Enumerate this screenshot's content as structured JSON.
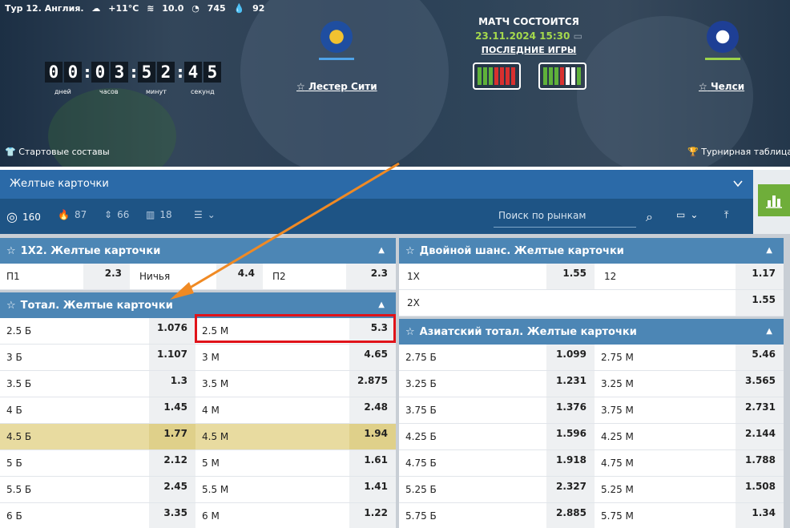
{
  "header": {
    "tour": "Тур 12. Англия.",
    "weather_temp": "+11°C",
    "wind": "10.0",
    "pressure": "745",
    "humidity": "92"
  },
  "countdown": {
    "digits": [
      "0",
      "0",
      "0",
      "3",
      "5",
      "2",
      "4",
      "5"
    ],
    "labels": [
      "дней",
      "часов",
      "минут",
      "секунд"
    ]
  },
  "match": {
    "status": "МАТЧ СОСТОИТСЯ",
    "datetime": "23.11.2024 15:30",
    "last_games": "ПОСЛЕДНИЕ ИГРЫ",
    "home": "Лестер Сити",
    "away": "Челси"
  },
  "links": {
    "lineups": "Стартовые составы",
    "table": "Турнирная таблица"
  },
  "market_select": "Желтые карточки",
  "toolbar": {
    "all": "160",
    "hot": "87",
    "updown": "66",
    "stats": "18",
    "search_placeholder": "Поиск по рынкам"
  },
  "panels": {
    "x12": {
      "title": "1X2. Желтые карточки",
      "cells": [
        {
          "label": "П1",
          "odd": "2.3"
        },
        {
          "label": "Ничья",
          "odd": "4.4"
        },
        {
          "label": "П2",
          "odd": "2.3"
        }
      ]
    },
    "total": {
      "title": "Тотал. Желтые карточки",
      "rows": [
        {
          "over": "2.5 Б",
          "over_odd": "1.076",
          "under": "2.5 М",
          "under_odd": "5.3"
        },
        {
          "over": "3 Б",
          "over_odd": "1.107",
          "under": "3 М",
          "under_odd": "4.65"
        },
        {
          "over": "3.5 Б",
          "over_odd": "1.3",
          "under": "3.5 М",
          "under_odd": "2.875"
        },
        {
          "over": "4 Б",
          "over_odd": "1.45",
          "under": "4 М",
          "under_odd": "2.48"
        },
        {
          "over": "4.5 Б",
          "over_odd": "1.77",
          "under": "4.5 М",
          "under_odd": "1.94"
        },
        {
          "over": "5 Б",
          "over_odd": "2.12",
          "under": "5 М",
          "under_odd": "1.61"
        },
        {
          "over": "5.5 Б",
          "over_odd": "2.45",
          "under": "5.5 М",
          "under_odd": "1.41"
        },
        {
          "over": "6 Б",
          "over_odd": "3.35",
          "under": "6 М",
          "under_odd": "1.22"
        }
      ]
    },
    "double": {
      "title": "Двойной шанс. Желтые карточки",
      "rows": [
        [
          {
            "label": "1X",
            "odd": "1.55"
          },
          {
            "label": "12",
            "odd": "1.17"
          }
        ],
        [
          {
            "label": "2X",
            "odd": "1.55"
          }
        ]
      ]
    },
    "asian": {
      "title": "Азиатский тотал. Желтые карточки",
      "rows": [
        {
          "over": "2.75 Б",
          "over_odd": "1.099",
          "under": "2.75 М",
          "under_odd": "5.46"
        },
        {
          "over": "3.25 Б",
          "over_odd": "1.231",
          "under": "3.25 М",
          "under_odd": "3.565"
        },
        {
          "over": "3.75 Б",
          "over_odd": "1.376",
          "under": "3.75 М",
          "under_odd": "2.731"
        },
        {
          "over": "4.25 Б",
          "over_odd": "1.596",
          "under": "4.25 М",
          "under_odd": "2.144"
        },
        {
          "over": "4.75 Б",
          "over_odd": "1.918",
          "under": "4.75 М",
          "under_odd": "1.788"
        },
        {
          "over": "5.25 Б",
          "over_odd": "2.327",
          "under": "5.25 М",
          "under_odd": "1.508"
        },
        {
          "over": "5.75 Б",
          "over_odd": "2.885",
          "under": "5.75 М",
          "under_odd": "1.34"
        }
      ]
    }
  },
  "colors": {
    "accent_blue": "#2b6aa8",
    "panel_header": "#4c86b5",
    "highlight_row": "#e8dba0",
    "annotation_red": "#e0131a",
    "annotation_orange": "#f08a24",
    "home_line": "#4fa3e8",
    "away_line": "#9bd34a"
  }
}
